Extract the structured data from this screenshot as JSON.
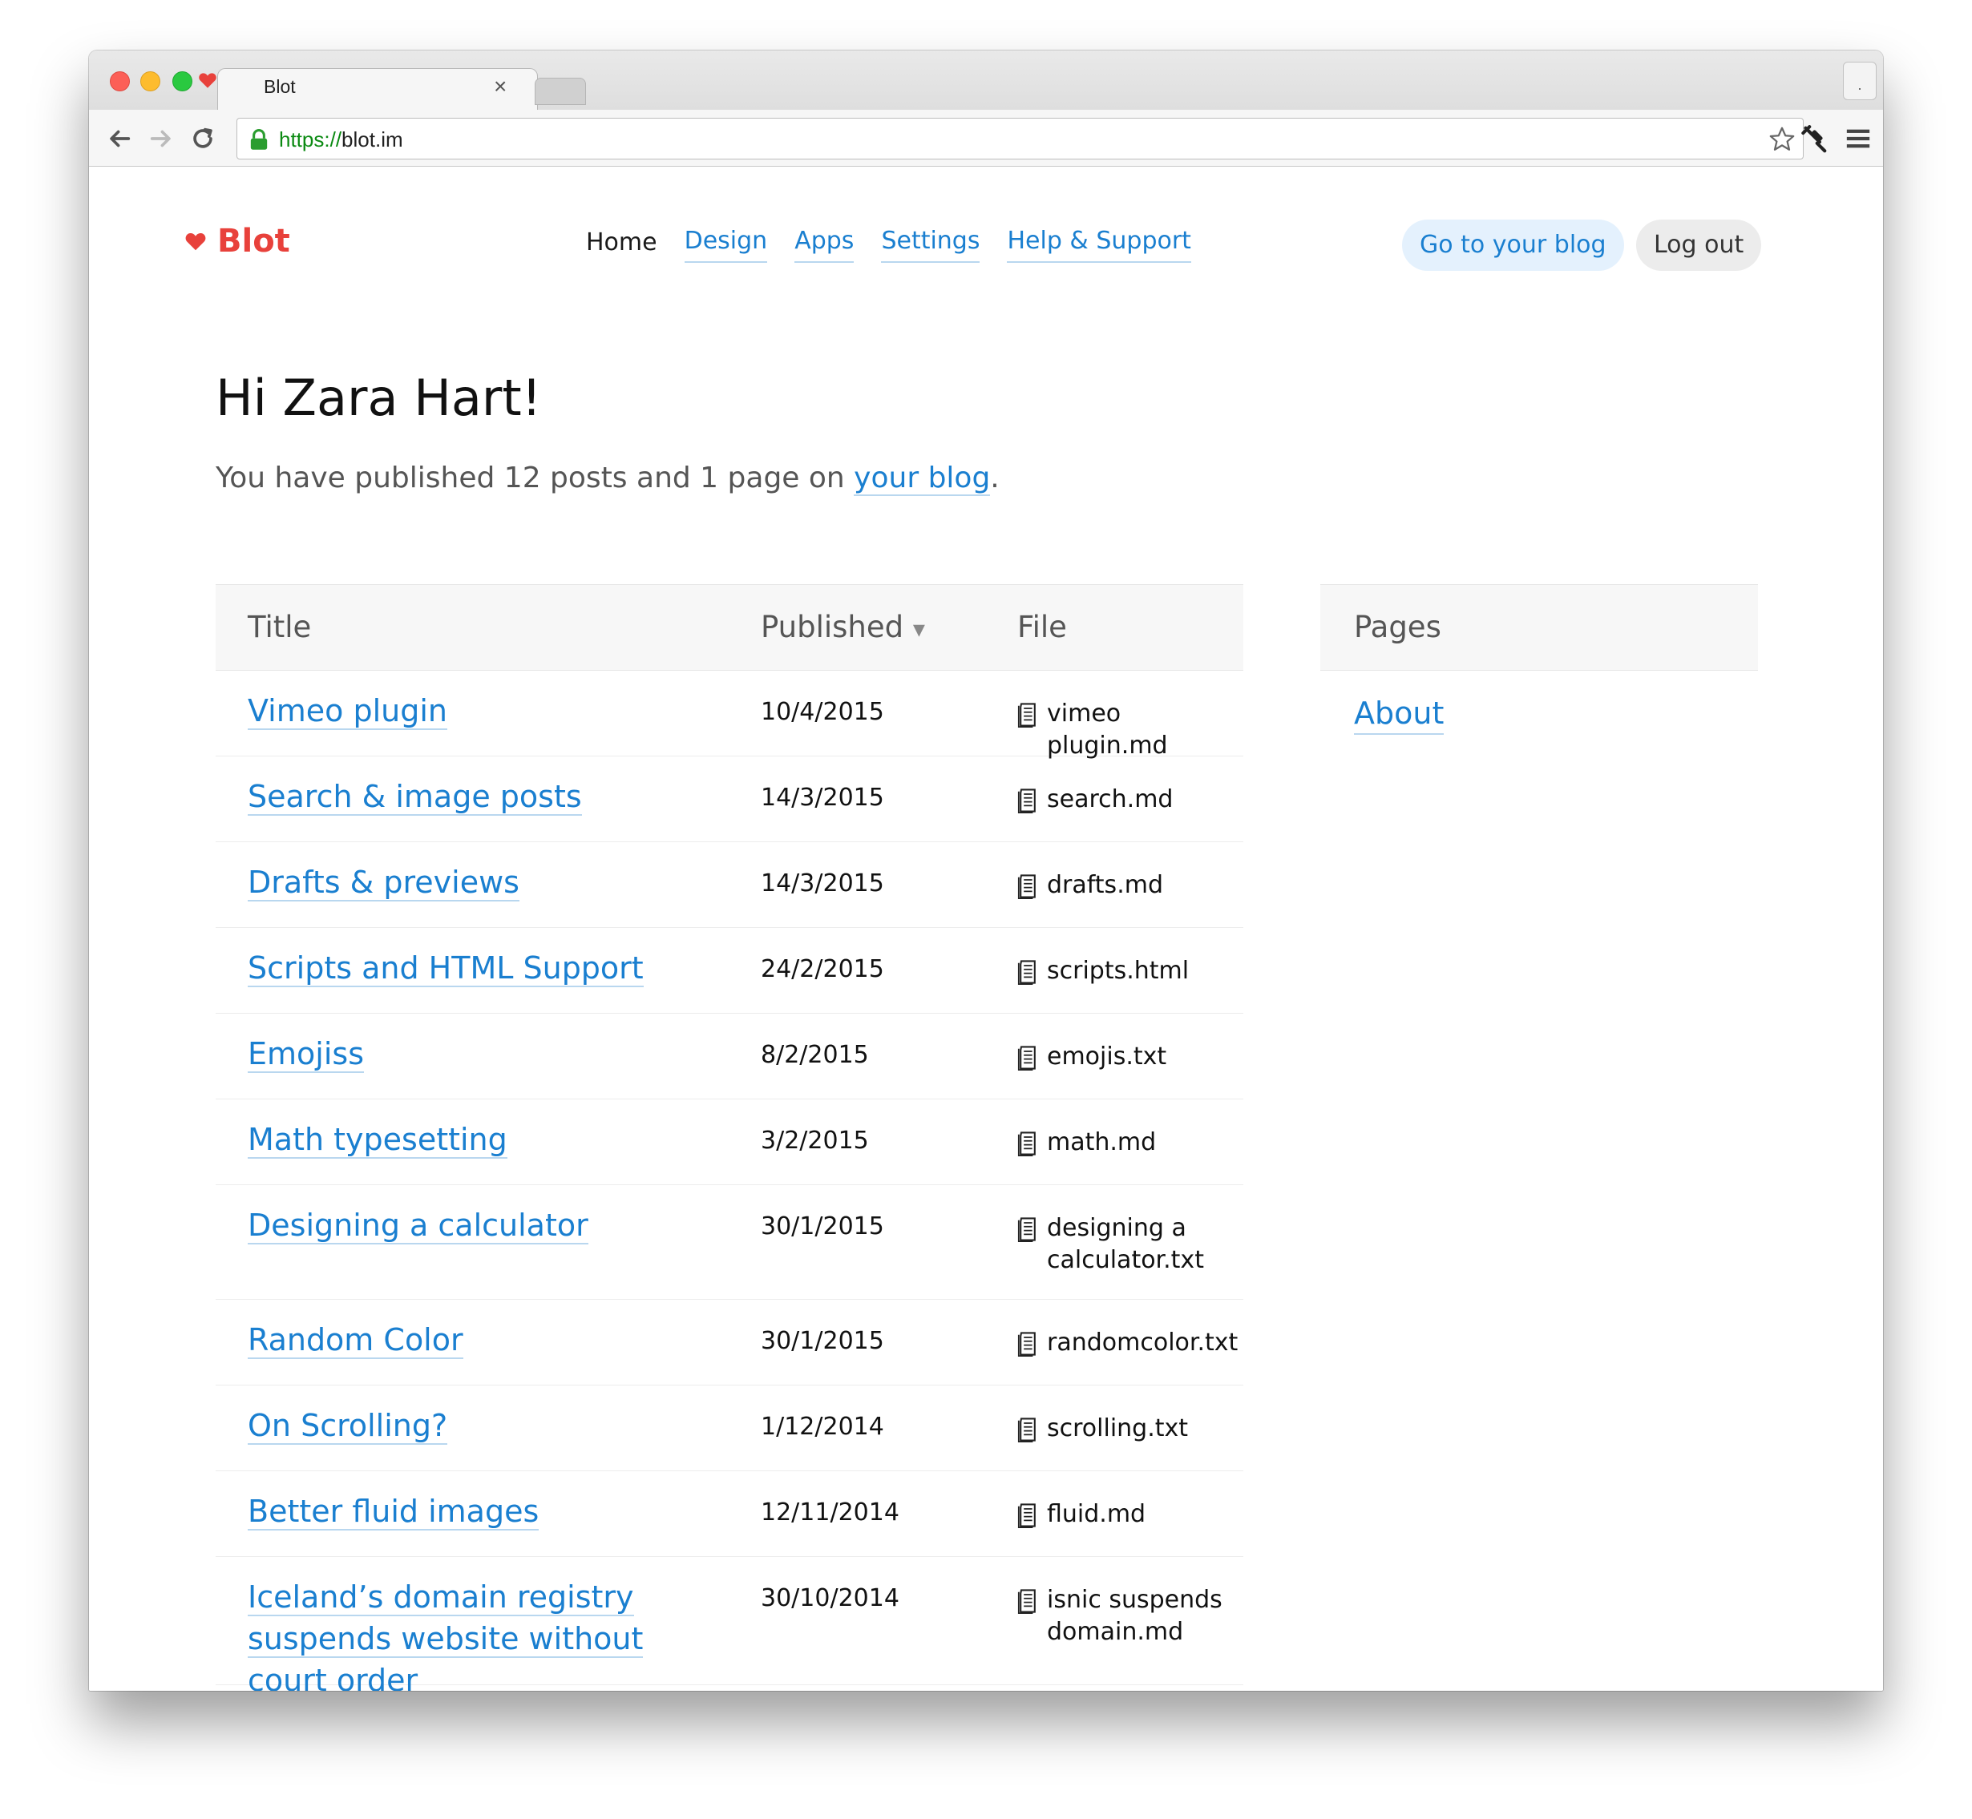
{
  "browser": {
    "tab_title": "Blot",
    "tab_close": "×",
    "url_scheme": "https://",
    "url_host": "blot.im",
    "profile_label": "."
  },
  "header": {
    "brand": "Blot",
    "nav": {
      "home": "Home",
      "design": "Design",
      "apps": "Apps",
      "settings": "Settings",
      "help": "Help & Support"
    },
    "go_to_blog": "Go to your blog",
    "log_out": "Log out"
  },
  "main": {
    "greeting": "Hi Zara Hart!",
    "summary_prefix": "You have published 12 posts and 1 page on ",
    "summary_link": "your blog",
    "summary_suffix": "."
  },
  "posts_table": {
    "columns": {
      "title": "Title",
      "published": "Published",
      "sort_indicator": "▾",
      "file": "File"
    },
    "rows": [
      {
        "title": "Vimeo plugin",
        "published": "10/4/2015",
        "file": "vimeo plugin.md"
      },
      {
        "title": "Search & image posts",
        "published": "14/3/2015",
        "file": "search.md"
      },
      {
        "title": "Drafts & previews",
        "published": "14/3/2015",
        "file": "drafts.md"
      },
      {
        "title": "Scripts and HTML Support",
        "published": "24/2/2015",
        "file": "scripts.html"
      },
      {
        "title": "Emojiss",
        "published": "8/2/2015",
        "file": "emojis.txt"
      },
      {
        "title": "Math typesetting",
        "published": "3/2/2015",
        "file": "math.md"
      },
      {
        "title": "Designing a calculator",
        "published": "30/1/2015",
        "file": "designing a calculator.txt"
      },
      {
        "title": "Random Color",
        "published": "30/1/2015",
        "file": "randomcolor.txt"
      },
      {
        "title": "On Scrolling?",
        "published": "1/12/2014",
        "file": "scrolling.txt"
      },
      {
        "title": "Better fluid images",
        "published": "12/11/2014",
        "file": "fluid.md"
      },
      {
        "title": "Iceland’s domain registry suspends website without court order",
        "published": "30/10/2014",
        "file": "isnic suspends domain.md"
      }
    ]
  },
  "pages_table": {
    "header": "Pages",
    "items": [
      "About"
    ]
  },
  "colors": {
    "brand_red": "#e8413b",
    "link_blue": "#1a7fd0",
    "secure_green": "#0b8a12"
  },
  "icons": {
    "file": "document-icon",
    "lock": "lock-icon",
    "heart": "heart-icon"
  }
}
